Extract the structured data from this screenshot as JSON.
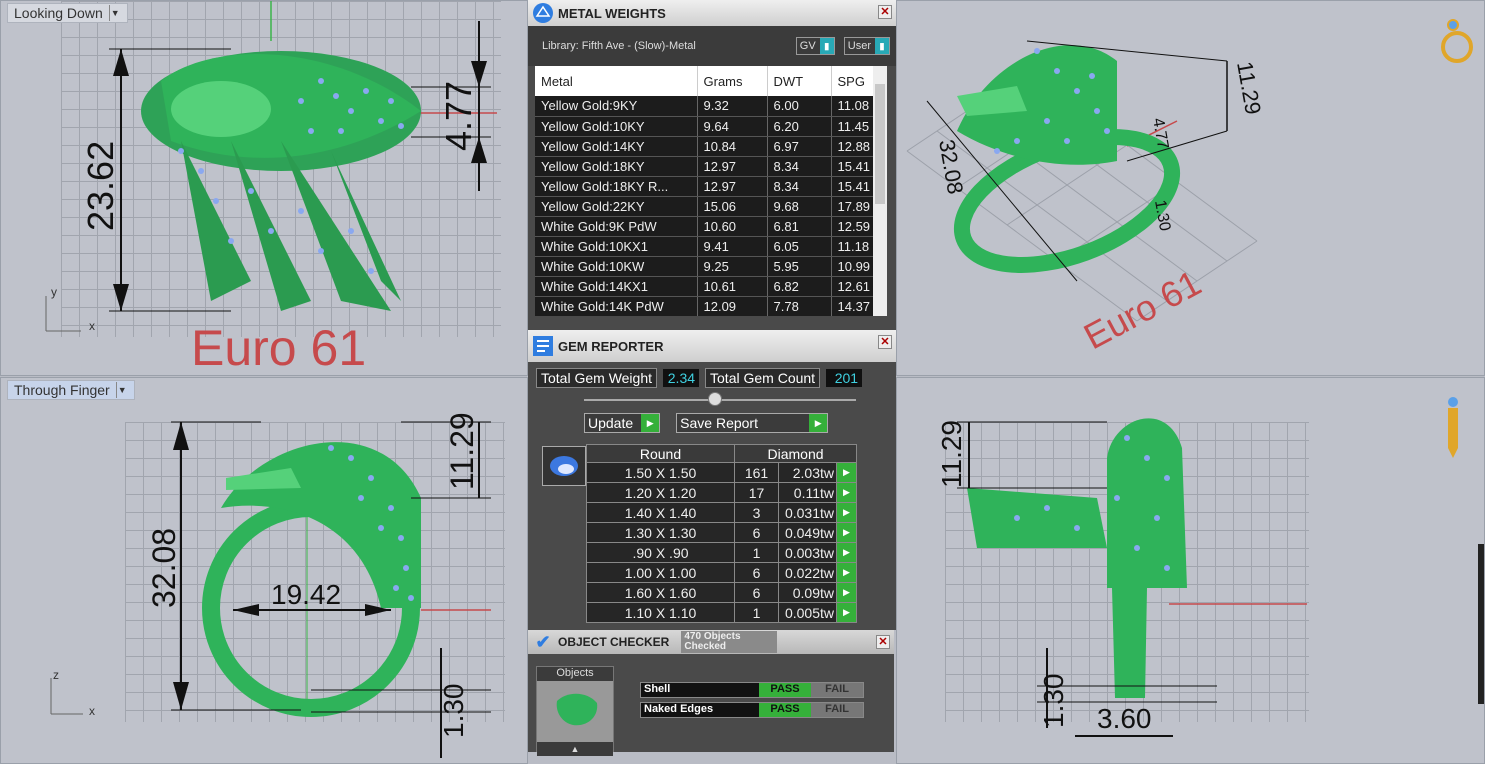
{
  "viewports": {
    "top_left": {
      "label": "Looking Down",
      "axis_y": "y",
      "axis_x": "x",
      "tag": "Euro 61",
      "dims": [
        "23.62",
        "4.77"
      ]
    },
    "bottom_left": {
      "label": "Through Finger",
      "axis_z": "z",
      "axis_x": "x",
      "dims": [
        "32.08",
        "11.29",
        "19.42",
        "1.30"
      ]
    },
    "top_right": {
      "tag": "Euro 61",
      "dims": [
        "11.29",
        "4.77",
        "32.08",
        "1.30"
      ]
    },
    "bottom_right": {
      "dims": [
        "11.29",
        "1.30",
        "3.60"
      ]
    }
  },
  "metal_weights": {
    "title": "METAL WEIGHTS",
    "library": "Library: Fifth Ave - (Slow)-Metal",
    "toggle_gv": "GV",
    "toggle_user": "User",
    "columns": [
      "Metal",
      "Grams",
      "DWT",
      "SPG"
    ],
    "rows": [
      [
        "Yellow Gold:9KY",
        "9.32",
        "6.00",
        "11.08"
      ],
      [
        "Yellow Gold:10KY",
        "9.64",
        "6.20",
        "11.45"
      ],
      [
        "Yellow Gold:14KY",
        "10.84",
        "6.97",
        "12.88"
      ],
      [
        "Yellow Gold:18KY",
        "12.97",
        "8.34",
        "15.41"
      ],
      [
        "Yellow Gold:18KY R...",
        "12.97",
        "8.34",
        "15.41"
      ],
      [
        "Yellow Gold:22KY",
        "15.06",
        "9.68",
        "17.89"
      ],
      [
        "White Gold:9K PdW",
        "10.60",
        "6.81",
        "12.59"
      ],
      [
        "White Gold:10KX1",
        "9.41",
        "6.05",
        "11.18"
      ],
      [
        "White Gold:10KW",
        "9.25",
        "5.95",
        "10.99"
      ],
      [
        "White Gold:14KX1",
        "10.61",
        "6.82",
        "12.61"
      ],
      [
        "White Gold:14K PdW",
        "12.09",
        "7.78",
        "14.37"
      ]
    ]
  },
  "gem_reporter": {
    "title": "GEM REPORTER",
    "total_weight_label": "Total Gem Weight",
    "total_weight": "2.34",
    "total_count_label": "Total Gem Count",
    "total_count": "201",
    "update_label": "Update",
    "save_label": "Save Report",
    "col_shape": "Round",
    "col_type": "Diamond",
    "rows": [
      [
        "1.50 X 1.50",
        "161",
        "2.03tw"
      ],
      [
        "1.20 X 1.20",
        "17",
        "0.11tw"
      ],
      [
        "1.40 X 1.40",
        "3",
        "0.031tw"
      ],
      [
        "1.30 X 1.30",
        "6",
        "0.049tw"
      ],
      [
        ".90 X .90",
        "1",
        "0.003tw"
      ],
      [
        "1.00 X 1.00",
        "6",
        "0.022tw"
      ],
      [
        "1.60 X 1.60",
        "6",
        "0.09tw"
      ],
      [
        "1.10 X 1.10",
        "1",
        "0.005tw"
      ]
    ]
  },
  "object_checker": {
    "title": "OBJECT CHECKER",
    "status": "470 Objects Checked",
    "objects_label": "Objects",
    "checks": [
      {
        "name": "Shell",
        "pass": "PASS",
        "fail": "FAIL"
      },
      {
        "name": "Naked Edges",
        "pass": "PASS",
        "fail": "FAIL"
      }
    ]
  },
  "colors": {
    "model_green": "#2fb35a",
    "gem_blue": "#8aa8f0",
    "dim_red": "#c64a4c",
    "pass_green": "#35b03a"
  }
}
